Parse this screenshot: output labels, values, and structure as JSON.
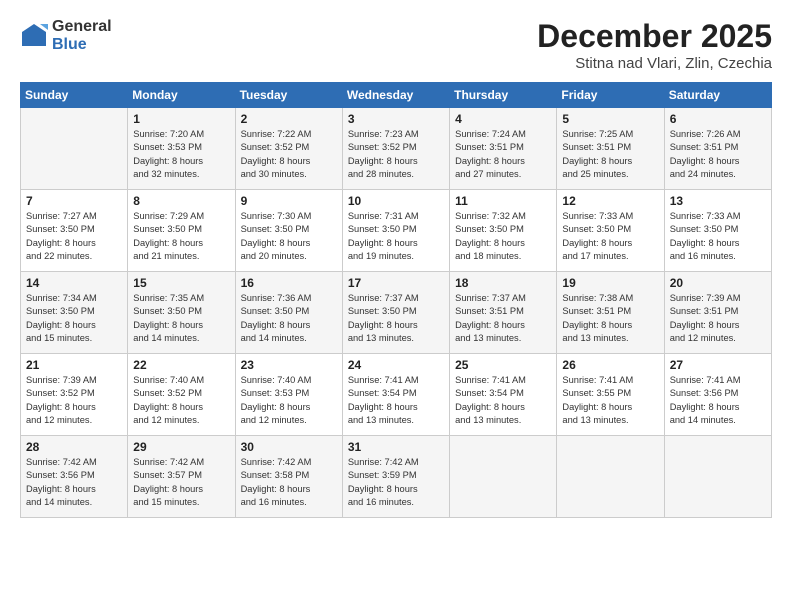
{
  "logo": {
    "general": "General",
    "blue": "Blue"
  },
  "title": "December 2025",
  "location": "Stitna nad Vlari, Zlin, Czechia",
  "headers": [
    "Sunday",
    "Monday",
    "Tuesday",
    "Wednesday",
    "Thursday",
    "Friday",
    "Saturday"
  ],
  "weeks": [
    [
      {
        "day": "",
        "info": ""
      },
      {
        "day": "1",
        "info": "Sunrise: 7:20 AM\nSunset: 3:53 PM\nDaylight: 8 hours\nand 32 minutes."
      },
      {
        "day": "2",
        "info": "Sunrise: 7:22 AM\nSunset: 3:52 PM\nDaylight: 8 hours\nand 30 minutes."
      },
      {
        "day": "3",
        "info": "Sunrise: 7:23 AM\nSunset: 3:52 PM\nDaylight: 8 hours\nand 28 minutes."
      },
      {
        "day": "4",
        "info": "Sunrise: 7:24 AM\nSunset: 3:51 PM\nDaylight: 8 hours\nand 27 minutes."
      },
      {
        "day": "5",
        "info": "Sunrise: 7:25 AM\nSunset: 3:51 PM\nDaylight: 8 hours\nand 25 minutes."
      },
      {
        "day": "6",
        "info": "Sunrise: 7:26 AM\nSunset: 3:51 PM\nDaylight: 8 hours\nand 24 minutes."
      }
    ],
    [
      {
        "day": "7",
        "info": "Sunrise: 7:27 AM\nSunset: 3:50 PM\nDaylight: 8 hours\nand 22 minutes."
      },
      {
        "day": "8",
        "info": "Sunrise: 7:29 AM\nSunset: 3:50 PM\nDaylight: 8 hours\nand 21 minutes."
      },
      {
        "day": "9",
        "info": "Sunrise: 7:30 AM\nSunset: 3:50 PM\nDaylight: 8 hours\nand 20 minutes."
      },
      {
        "day": "10",
        "info": "Sunrise: 7:31 AM\nSunset: 3:50 PM\nDaylight: 8 hours\nand 19 minutes."
      },
      {
        "day": "11",
        "info": "Sunrise: 7:32 AM\nSunset: 3:50 PM\nDaylight: 8 hours\nand 18 minutes."
      },
      {
        "day": "12",
        "info": "Sunrise: 7:33 AM\nSunset: 3:50 PM\nDaylight: 8 hours\nand 17 minutes."
      },
      {
        "day": "13",
        "info": "Sunrise: 7:33 AM\nSunset: 3:50 PM\nDaylight: 8 hours\nand 16 minutes."
      }
    ],
    [
      {
        "day": "14",
        "info": "Sunrise: 7:34 AM\nSunset: 3:50 PM\nDaylight: 8 hours\nand 15 minutes."
      },
      {
        "day": "15",
        "info": "Sunrise: 7:35 AM\nSunset: 3:50 PM\nDaylight: 8 hours\nand 14 minutes."
      },
      {
        "day": "16",
        "info": "Sunrise: 7:36 AM\nSunset: 3:50 PM\nDaylight: 8 hours\nand 14 minutes."
      },
      {
        "day": "17",
        "info": "Sunrise: 7:37 AM\nSunset: 3:50 PM\nDaylight: 8 hours\nand 13 minutes."
      },
      {
        "day": "18",
        "info": "Sunrise: 7:37 AM\nSunset: 3:51 PM\nDaylight: 8 hours\nand 13 minutes."
      },
      {
        "day": "19",
        "info": "Sunrise: 7:38 AM\nSunset: 3:51 PM\nDaylight: 8 hours\nand 13 minutes."
      },
      {
        "day": "20",
        "info": "Sunrise: 7:39 AM\nSunset: 3:51 PM\nDaylight: 8 hours\nand 12 minutes."
      }
    ],
    [
      {
        "day": "21",
        "info": "Sunrise: 7:39 AM\nSunset: 3:52 PM\nDaylight: 8 hours\nand 12 minutes."
      },
      {
        "day": "22",
        "info": "Sunrise: 7:40 AM\nSunset: 3:52 PM\nDaylight: 8 hours\nand 12 minutes."
      },
      {
        "day": "23",
        "info": "Sunrise: 7:40 AM\nSunset: 3:53 PM\nDaylight: 8 hours\nand 12 minutes."
      },
      {
        "day": "24",
        "info": "Sunrise: 7:41 AM\nSunset: 3:54 PM\nDaylight: 8 hours\nand 13 minutes."
      },
      {
        "day": "25",
        "info": "Sunrise: 7:41 AM\nSunset: 3:54 PM\nDaylight: 8 hours\nand 13 minutes."
      },
      {
        "day": "26",
        "info": "Sunrise: 7:41 AM\nSunset: 3:55 PM\nDaylight: 8 hours\nand 13 minutes."
      },
      {
        "day": "27",
        "info": "Sunrise: 7:41 AM\nSunset: 3:56 PM\nDaylight: 8 hours\nand 14 minutes."
      }
    ],
    [
      {
        "day": "28",
        "info": "Sunrise: 7:42 AM\nSunset: 3:56 PM\nDaylight: 8 hours\nand 14 minutes."
      },
      {
        "day": "29",
        "info": "Sunrise: 7:42 AM\nSunset: 3:57 PM\nDaylight: 8 hours\nand 15 minutes."
      },
      {
        "day": "30",
        "info": "Sunrise: 7:42 AM\nSunset: 3:58 PM\nDaylight: 8 hours\nand 16 minutes."
      },
      {
        "day": "31",
        "info": "Sunrise: 7:42 AM\nSunset: 3:59 PM\nDaylight: 8 hours\nand 16 minutes."
      },
      {
        "day": "",
        "info": ""
      },
      {
        "day": "",
        "info": ""
      },
      {
        "day": "",
        "info": ""
      }
    ]
  ]
}
